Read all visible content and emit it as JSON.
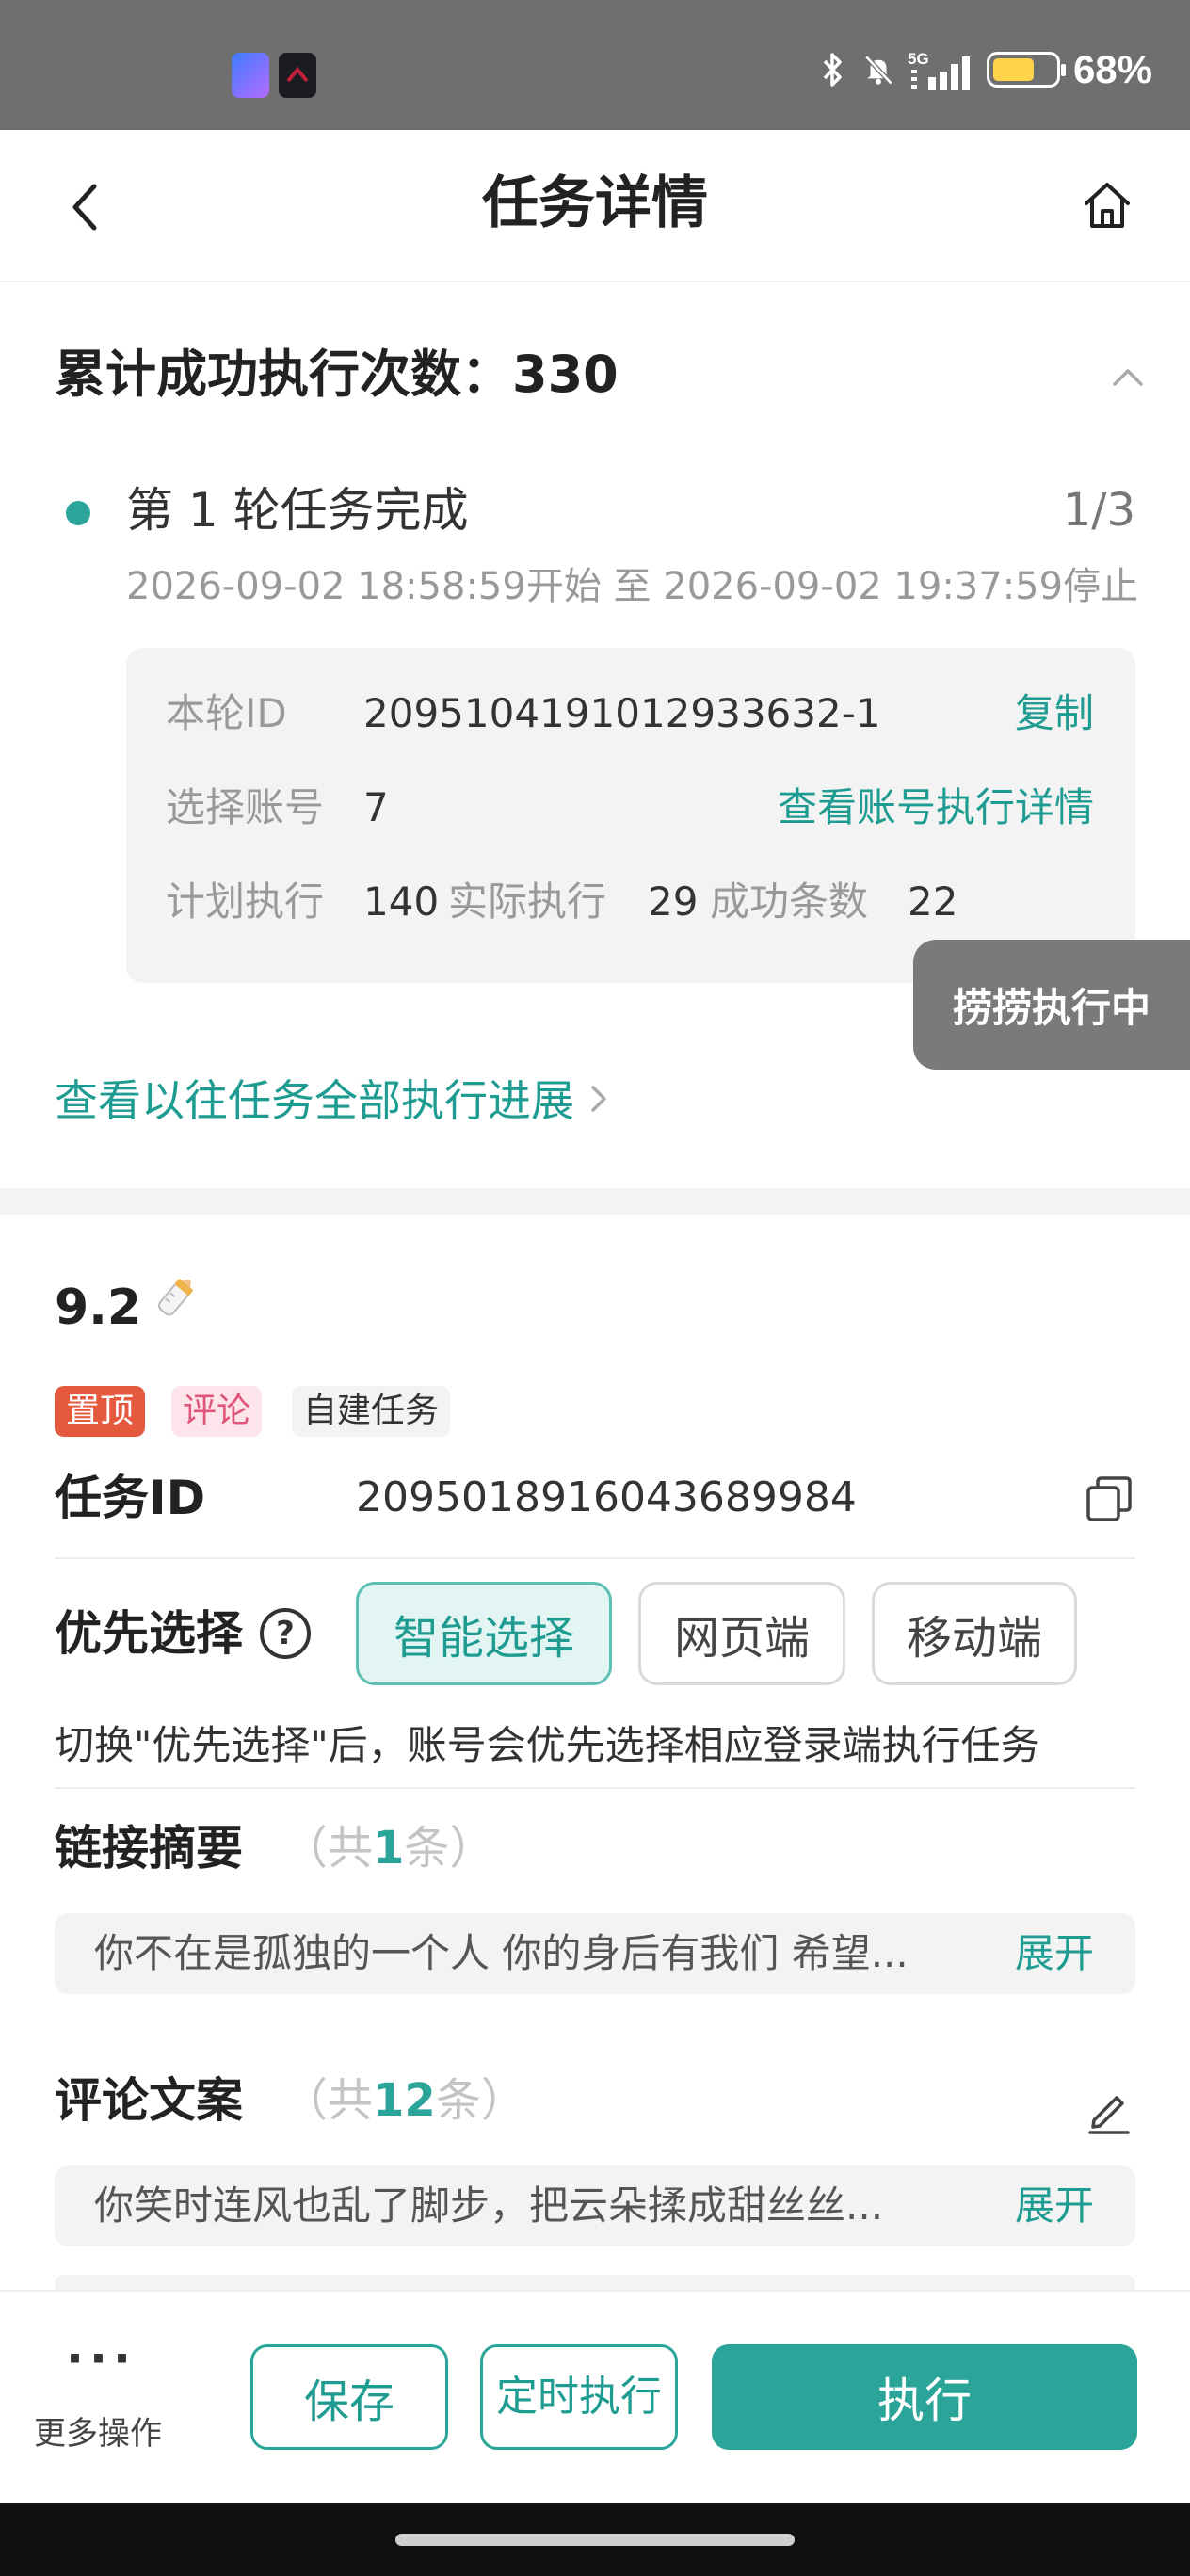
{
  "status_bar": {
    "network": "5G",
    "battery": "68%",
    "battery_level": 0.68,
    "icons": [
      "bluetooth-icon",
      "mute-icon",
      "signal-icon",
      "battery-icon"
    ]
  },
  "header": {
    "title": "任务详情",
    "back_icon": "back-arrow-icon",
    "home_icon": "home-icon"
  },
  "progress": {
    "cumulative_label": "累计成功执行次数：330",
    "round_title": "第 1 轮任务完成",
    "round_count": "1/3",
    "round_time": "2026-09-02 18:58:59开始 至 2026-09-02 19:37:59停止",
    "round_id_label": "本轮ID",
    "round_id": "2095104191012933632-1",
    "copy_label": "复制",
    "account_label": "选择账号",
    "account_value": "7",
    "account_detail_link": "查看账号执行详情",
    "plan_label": "计划执行",
    "plan_value": "140",
    "actual_label": "实际执行",
    "actual_value": "29",
    "success_label": "成功条数",
    "success_value": "22",
    "history_link": "查看以往任务全部执行进展"
  },
  "toast": "捞捞执行中",
  "task": {
    "name": "9.2",
    "name_icon": "baby-bottle-emoji",
    "tags": {
      "pin": "置顶",
      "comment": "评论",
      "self_built": "自建任务"
    },
    "id_label": "任务ID",
    "id_value": "2095018916043689984",
    "priority_label": "优先选择",
    "priority_options": {
      "smart": "智能选择",
      "web": "网页端",
      "mobile": "移动端"
    },
    "priority_selected": "智能选择",
    "priority_hint": "切换\"优先选择\"后，账号会优先选择相应登录端执行任务",
    "link_summary": {
      "title": "链接摘要",
      "count_prefix": "（共",
      "count": "1",
      "count_suffix": "条）",
      "text": "你不在是孤独的一个人 你的身后有我们 希望...",
      "expand": "展开"
    },
    "comment_copy": {
      "title": "评论文案",
      "count_prefix": "（共",
      "count": "12",
      "count_suffix": "条）",
      "text": "你笑时连风也乱了脚步，把云朵揉成甜丝丝...",
      "expand": "展开"
    }
  },
  "bottom_bar": {
    "more_label": "更多操作",
    "save": "保存",
    "schedule": "定时执行",
    "run": "执行"
  },
  "colors": {
    "accent": "#2ba59a",
    "status_bar": "#6f6f6f",
    "tag_pin": "#e55a3f",
    "tag_comment": "#e0557a",
    "battery": "#ffd44a"
  }
}
